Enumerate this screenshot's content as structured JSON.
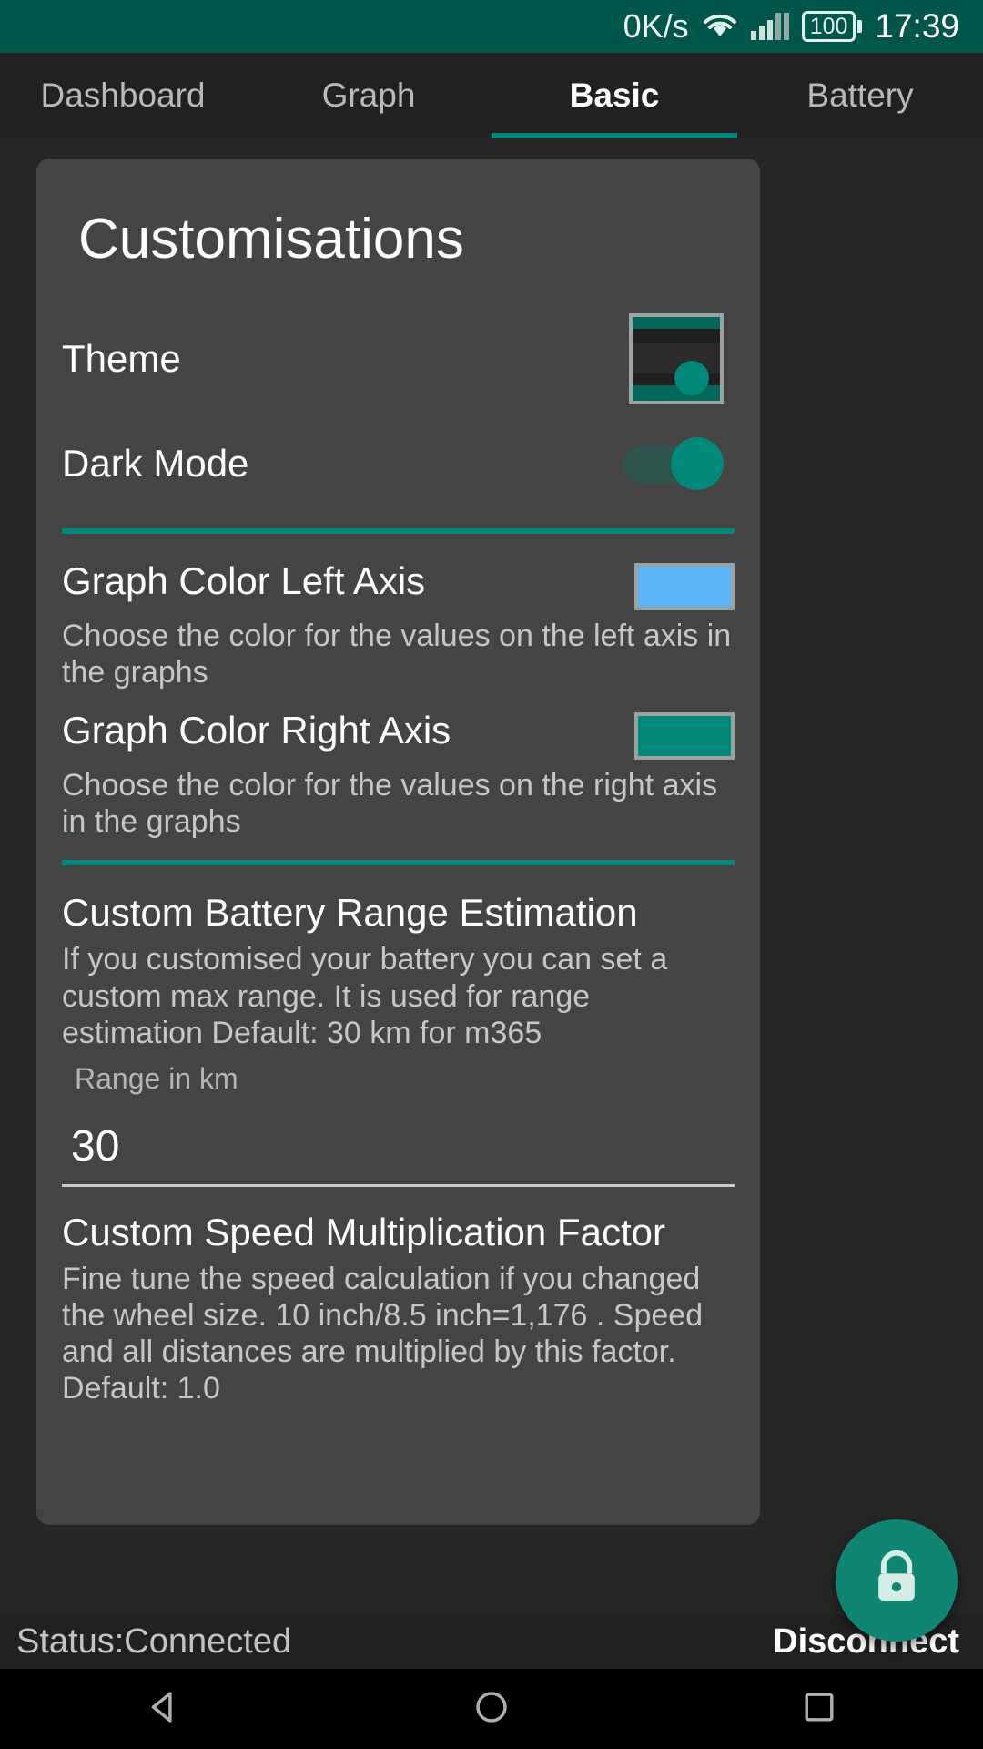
{
  "status_bar": {
    "network_speed": "0K/s",
    "wifi_icon": "wifi-icon",
    "signal_icon": "signal-bars-icon",
    "battery_level": "100",
    "time": "17:39"
  },
  "tabs": [
    {
      "label": "Dashboard",
      "active": false
    },
    {
      "label": "Graph",
      "active": false
    },
    {
      "label": "Basic",
      "active": true
    },
    {
      "label": "Battery",
      "active": false
    }
  ],
  "card": {
    "title": "Customisations",
    "theme": {
      "label": "Theme",
      "preview_icon": "theme-preview-thumbnail"
    },
    "dark_mode": {
      "label": "Dark Mode",
      "state": "on"
    },
    "graph_left": {
      "title": "Graph Color Left Axis",
      "description": "Choose the color for the values on the left axis in the graphs",
      "color": "#5BB3F5"
    },
    "graph_right": {
      "title": "Graph Color Right Axis",
      "description": "Choose the color for the values on the right axis in the graphs",
      "color": "#00897B"
    },
    "battery_range": {
      "title": "Custom Battery Range Estimation",
      "description": "If you customised your battery you can set a custom max range. It is used for range estimation Default: 30 km for m365",
      "field_label": "Range in km",
      "field_value": "30"
    },
    "speed_factor": {
      "title": "Custom Speed Multiplication Factor",
      "description": "Fine tune the speed calculation if you changed the wheel size. 10 inch/8.5 inch=1,176 . Speed and all distances are multiplied by this factor. Default: 1.0"
    }
  },
  "fab": {
    "icon": "lock-closed-icon"
  },
  "bottom_bar": {
    "status": "Status:Connected",
    "action": "Disconnect"
  },
  "nav_bar": {
    "back_icon": "back-triangle-icon",
    "home_icon": "home-circle-icon",
    "recents_icon": "recents-square-icon"
  },
  "colors": {
    "accent": "#00897B",
    "status_bar_bg": "#00564A",
    "card_bg": "#444444",
    "page_bg": "#262626"
  }
}
